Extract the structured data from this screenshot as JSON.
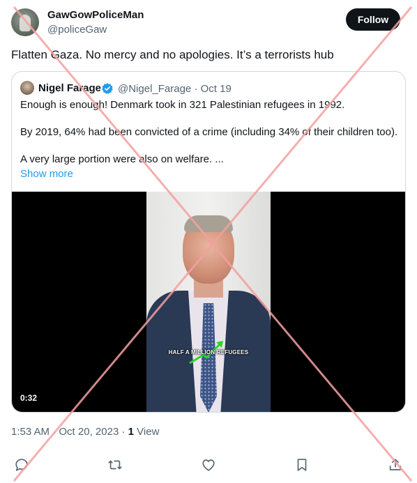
{
  "author": {
    "name": "GawGowPoliceMan",
    "handle": "@policeGaw",
    "avatar_icon": "profile-photo"
  },
  "follow_button": {
    "label": "Follow"
  },
  "tweet": {
    "text": "Flatten Gaza. No mercy and no apologies. It’s a terrorists hub"
  },
  "quoted_tweet": {
    "author_name": "Nigel Farage",
    "verified_icon": "verified-badge-icon",
    "handle": "@Nigel_Farage",
    "separator": "·",
    "date": "Oct 19",
    "line1": "Enough is enough! Denmark took in 321 Palestinian refugees in 1992.",
    "line2": "By 2019, 64% had been convicted of a crime (including 34% of their children too).",
    "line3": "A very large portion were also on welfare. ...",
    "show_more": "Show more",
    "video": {
      "caption": "HALF A MILLION REFUGEES",
      "duration": "0:32"
    }
  },
  "meta": {
    "time": "1:53 AM",
    "separator1": "·",
    "date": "Oct 20, 2023",
    "separator2": "·",
    "views_count": "1",
    "views_label": "View"
  },
  "actions": [
    "reply-icon",
    "retweet-icon",
    "like-icon",
    "bookmark-icon",
    "share-icon"
  ],
  "colors": {
    "accent": "#1d9bf0",
    "secondary_text": "#536471",
    "primary_text": "#0f1419",
    "watermark": "#f5a0a0"
  }
}
